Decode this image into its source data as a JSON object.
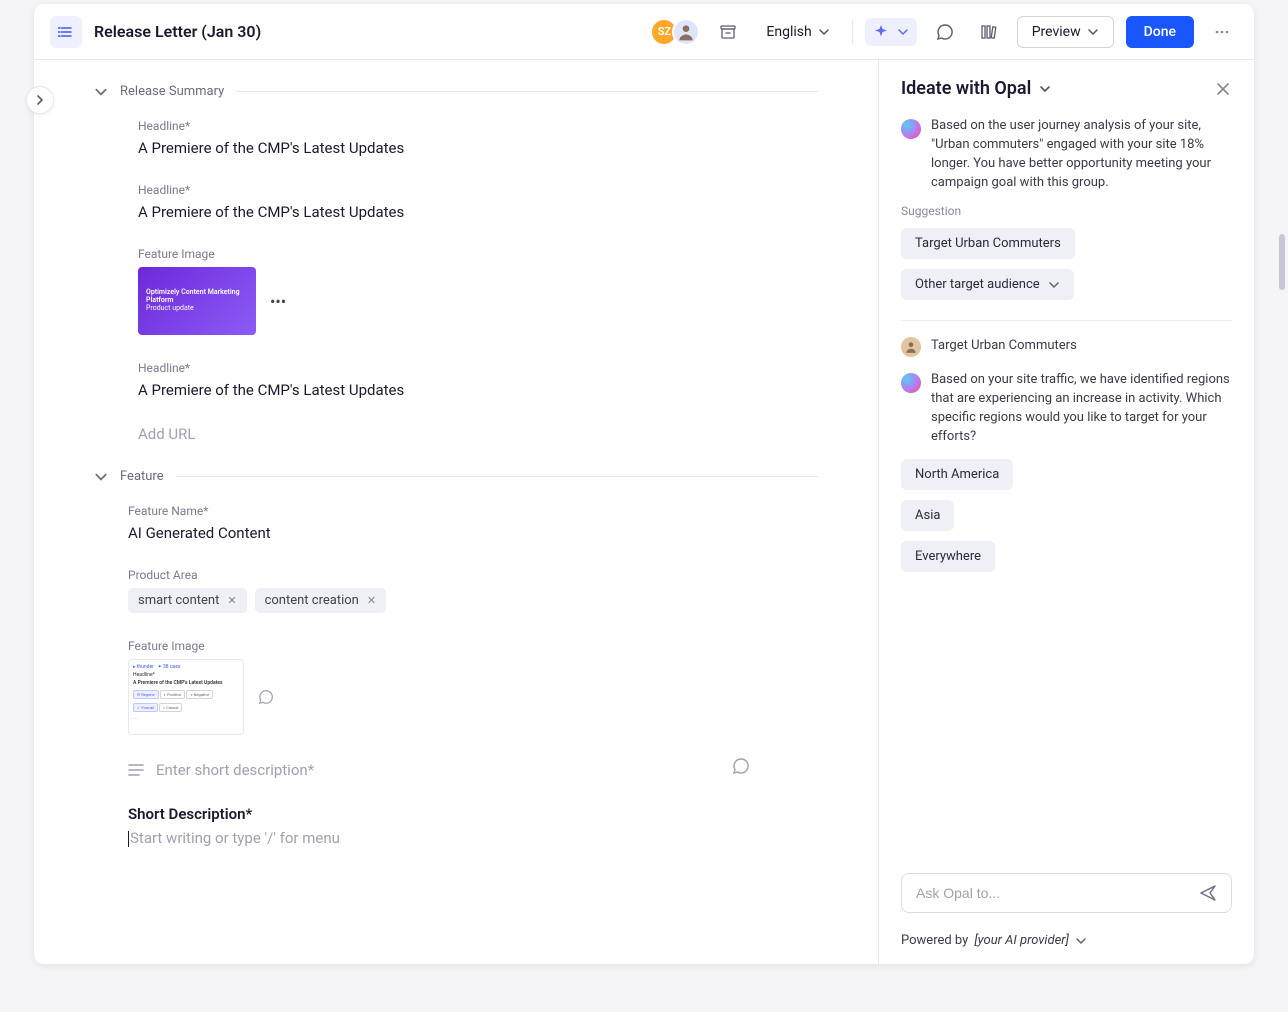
{
  "header": {
    "title": "Release Letter (Jan 30)",
    "avatar_initials": "SZ",
    "language": "English",
    "preview_label": "Preview",
    "done_label": "Done"
  },
  "sections": {
    "release_summary": {
      "title": "Release Summary",
      "headline1_label": "Headline*",
      "headline1_value": "A Premiere of the CMP's Latest Updates",
      "headline2_label": "Headline*",
      "headline2_value": "A Premiere of the CMP's Latest Updates",
      "feature_image_label": "Feature Image",
      "feature_image_text1": "Optimizely Content Marketing Platform",
      "feature_image_text2": "Product update",
      "headline3_label": "Headline*",
      "headline3_value": "A Premiere of the CMP's Latest Updates",
      "add_url_placeholder": "Add URL"
    },
    "feature": {
      "title": "Feature",
      "name_label": "Feature Name*",
      "name_value": "AI Generated Content",
      "product_area_label": "Product Area",
      "tag1": "smart content",
      "tag2": "content creation",
      "feature_image_label": "Feature Image",
      "short_desc_placeholder": "Enter short description*",
      "short_desc_label": "Short Description*",
      "short_desc_input_placeholder": "Start writing or type '/' for menu"
    }
  },
  "opal": {
    "title": "Ideate with Opal",
    "msg1": "Based on the user journey analysis of your site, \"Urban commuters\" engaged with your site 18% longer. You have better opportunity meeting your campaign goal with this group.",
    "suggestion_label": "Suggestion",
    "chip_target": "Target Urban Commuters",
    "chip_other": "Other target audience",
    "user_msg": "Target Urban Commuters",
    "msg2": "Based on your site traffic, we have identified regions that are experiencing an increase in activity. Which specific regions would you like to target for your efforts?",
    "chip_na": "North America",
    "chip_asia": "Asia",
    "chip_everywhere": "Everywhere",
    "input_placeholder": "Ask Opal to...",
    "powered_by": "Powered by",
    "provider": "[your AI provider]"
  }
}
